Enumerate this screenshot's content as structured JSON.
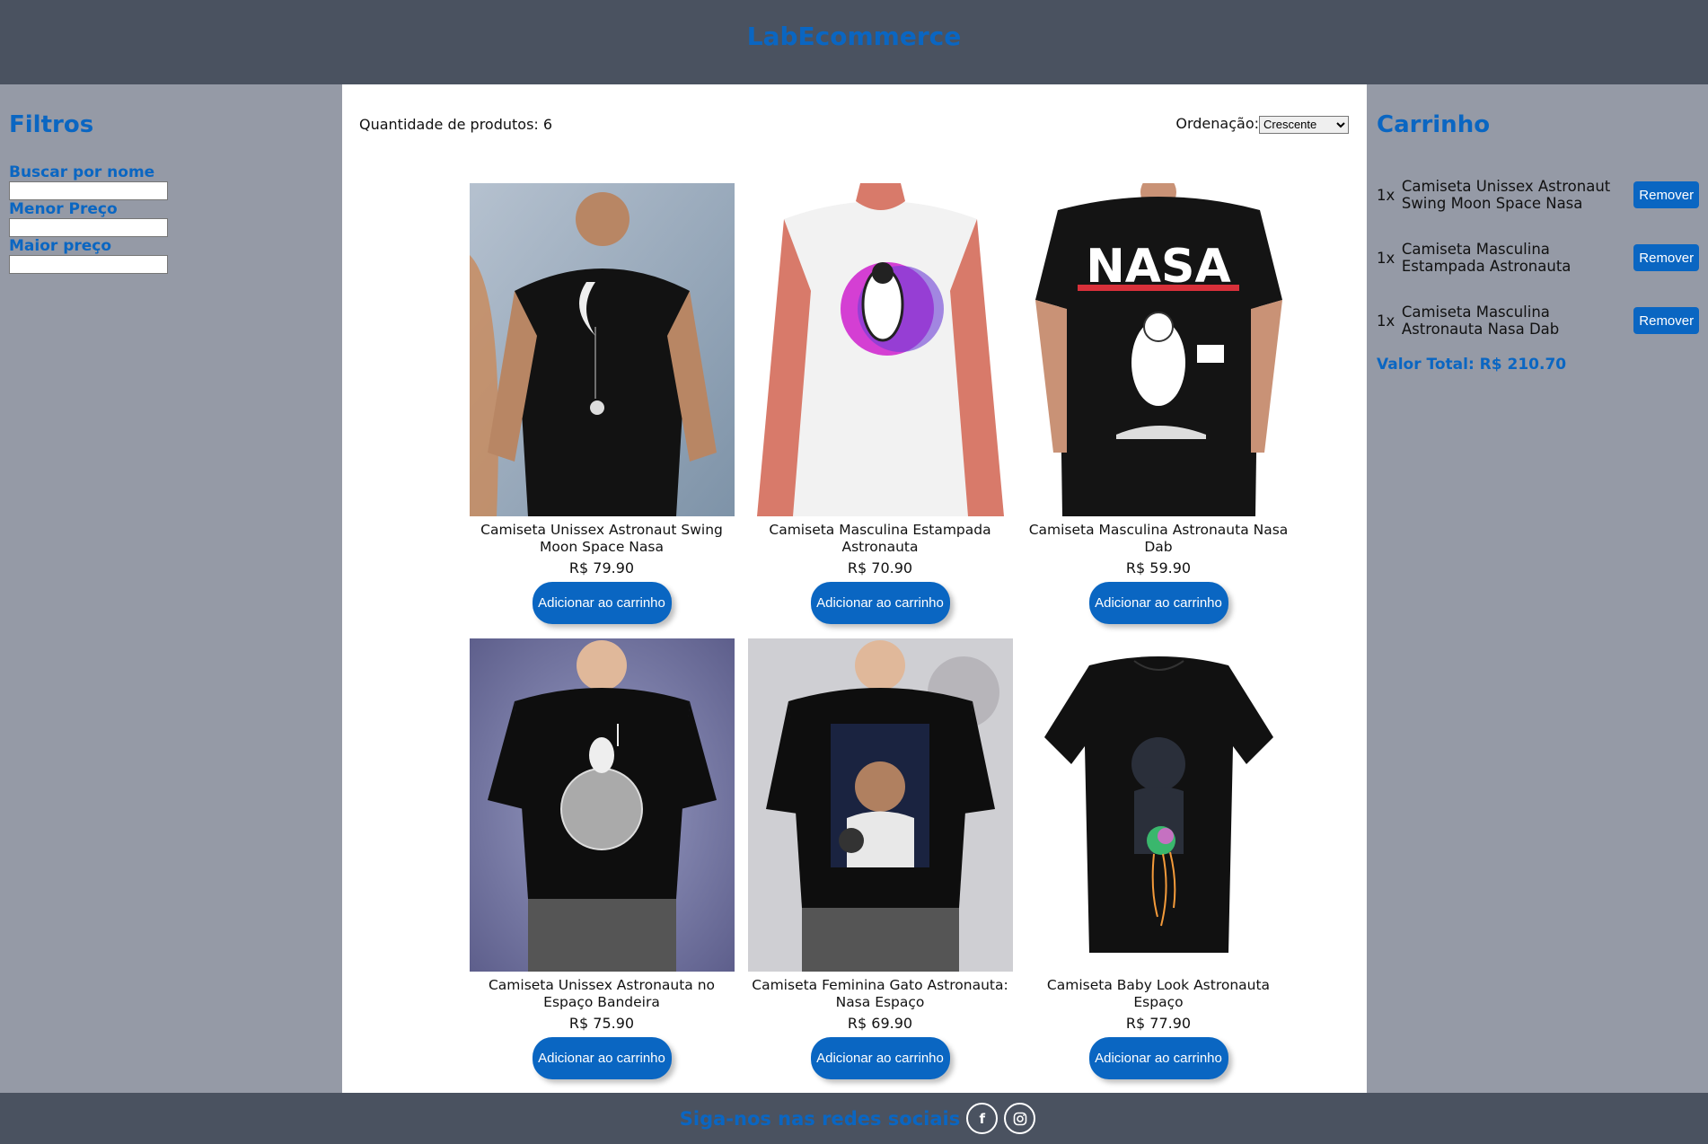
{
  "header": {
    "title": "LabEcommerce"
  },
  "filters": {
    "title": "Filtros",
    "search_label": "Buscar por nome",
    "min_label": "Menor Preço",
    "max_label": "Maior preço"
  },
  "toolbar": {
    "count_label": "Quantidade de produtos: 6",
    "sort_label": "Ordenação:",
    "sort_value": "Crescente"
  },
  "products": [
    {
      "name": "Camiseta Unissex Astronaut Swing Moon Space Nasa",
      "price": "R$ 79.90",
      "button": "Adicionar ao carrinho"
    },
    {
      "name": "Camiseta Masculina Estampada Astronauta",
      "price": "R$ 70.90",
      "button": "Adicionar ao carrinho"
    },
    {
      "name": "Camiseta Masculina Astronauta Nasa Dab",
      "price": "R$ 59.90",
      "button": "Adicionar ao carrinho"
    },
    {
      "name": "Camiseta Unissex Astronauta no Espaço Bandeira",
      "price": "R$ 75.90",
      "button": "Adicionar ao carrinho"
    },
    {
      "name": "Camiseta Feminina Gato Astronauta: Nasa Espaço",
      "price": "R$ 69.90",
      "button": "Adicionar ao carrinho"
    },
    {
      "name": "Camiseta Baby Look Astronauta Espaço",
      "price": "R$ 77.90",
      "button": "Adicionar ao carrinho"
    }
  ],
  "product_print_text": {
    "nasa_logo": "NASA"
  },
  "cart": {
    "title": "Carrinho",
    "items": [
      {
        "qty": "1x",
        "name": "Camiseta Unissex Astronaut Swing Moon Space Nasa",
        "button": "Remover"
      },
      {
        "qty": "1x",
        "name": "Camiseta Masculina Estampada Astronauta",
        "button": "Remover"
      },
      {
        "qty": "1x",
        "name": "Camiseta Masculina Astronauta Nasa Dab",
        "button": "Remover"
      }
    ],
    "total": "Valor Total: R$ 210.70"
  },
  "footer": {
    "text": "Siga-nos nas redes sociais",
    "icons": [
      "facebook-icon",
      "instagram-icon"
    ]
  },
  "colors": {
    "accent": "#0a66c2",
    "header_bg": "#4a5260",
    "sidebar_bg": "#959aa6"
  }
}
